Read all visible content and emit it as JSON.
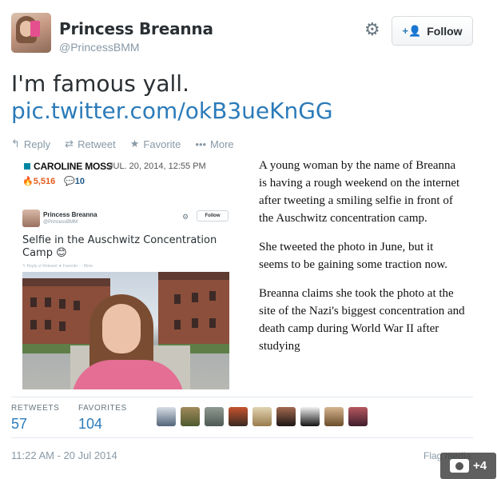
{
  "user": {
    "name": "Princess Breanna",
    "handle": "@PrincessBMM"
  },
  "header": {
    "gear_icon": "gear-icon",
    "follow_label": "Follow",
    "follow_icon": "add-user-icon"
  },
  "tweet": {
    "text": "I'm famous yall.",
    "link": "pic.twitter.com/okB3ueKnGG"
  },
  "actions": {
    "reply": "Reply",
    "retweet": "Retweet",
    "favorite": "Favorite",
    "more": "More"
  },
  "media": {
    "author": "CAROLINE MOSS",
    "date": "JUL. 20, 2014, 12:55 PM",
    "shares": "5,516",
    "comments": "10",
    "inner_tweet": {
      "name": "Princess Breanna",
      "handle": "@PrincessBMM",
      "follow_label": "Follow",
      "text": "Selfie in the Auschwitz Concentration Camp 😊",
      "actions": "↰ Reply  ⇄ Retweet  ★ Favorite  ··· More"
    },
    "article": [
      "A young woman by the name of Breanna is having a rough weekend on the internet after tweeting a smiling selfie in front of the Auschwitz concentration camp.",
      "She tweeted the photo in June, but it seems to be gaining some traction now.",
      "Breanna claims she took the photo at the site of the Nazi's biggest concentration and death camp during World War II after studying"
    ]
  },
  "stats": {
    "retweets_label": "RETWEETS",
    "retweets_value": "57",
    "favorites_label": "FAVORITES",
    "favorites_value": "104"
  },
  "footer": {
    "timestamp": "11:22 AM - 20 Jul 2014",
    "flag": "Flag media",
    "photo_count": "+4"
  },
  "colors": {
    "link": "#2b7bb9",
    "muted": "#8899a6",
    "text": "#292f33"
  }
}
